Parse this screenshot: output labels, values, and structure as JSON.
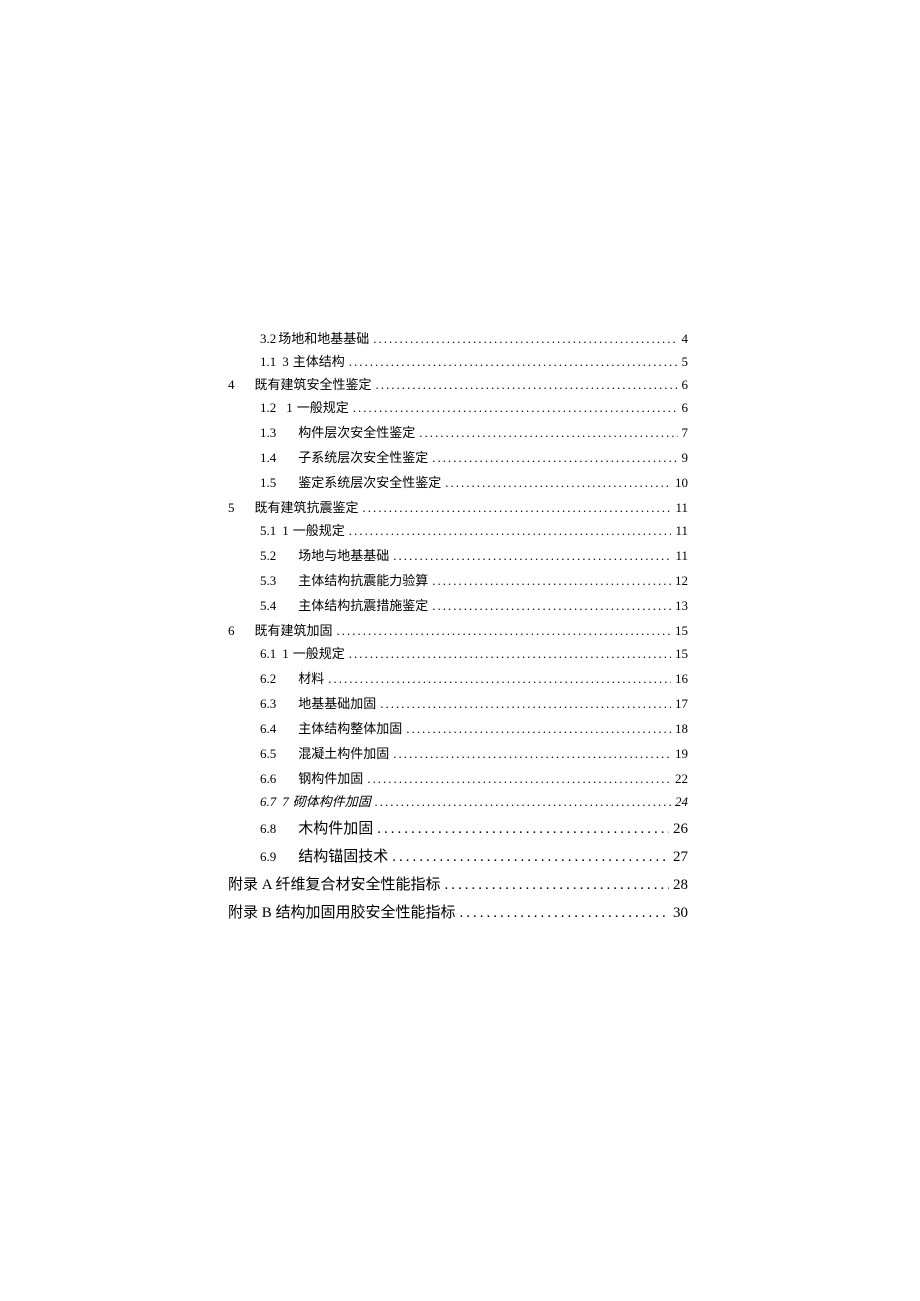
{
  "toc": {
    "r0": {
      "num": "3.2",
      "sub": "",
      "title": "场地和地基基础",
      "page": "4"
    },
    "r1": {
      "num": "1.1",
      "sub": "3",
      "title": "主体结构",
      "page": "5"
    },
    "r2": {
      "num": "4",
      "sub": "",
      "title": "既有建筑安全性鉴定",
      "page": "6"
    },
    "r3": {
      "num": "1.2",
      "sub": "1",
      "title": "一般规定",
      "page": "6"
    },
    "r4": {
      "num": "1.3",
      "sub": "",
      "title": "构件层次安全性鉴定",
      "page": "7"
    },
    "r5": {
      "num": "1.4",
      "sub": "",
      "title": "子系统层次安全性鉴定",
      "page": "9"
    },
    "r6": {
      "num": "1.5",
      "sub": "",
      "title": "鉴定系统层次安全性鉴定",
      "page": "10"
    },
    "r7": {
      "num": "5",
      "sub": "",
      "title": "既有建筑抗震鉴定",
      "page": "11"
    },
    "r8": {
      "num": "5.1",
      "sub": "1",
      "title": "一般规定",
      "page": "11"
    },
    "r9": {
      "num": "5.2",
      "sub": "",
      "title": "场地与地基基础",
      "page": "11"
    },
    "r10": {
      "num": "5.3",
      "sub": "",
      "title": "主体结构抗震能力验算",
      "page": "12"
    },
    "r11": {
      "num": "5.4",
      "sub": "",
      "title": "主体结构抗震措施鉴定",
      "page": "13"
    },
    "r12": {
      "num": "6",
      "sub": "",
      "title": "既有建筑加固",
      "page": "15"
    },
    "r13": {
      "num": "6.1",
      "sub": "1",
      "title": "一般规定",
      "page": "15"
    },
    "r14": {
      "num": "6.2",
      "sub": "",
      "title": "材料",
      "page": "16"
    },
    "r15": {
      "num": "6.3",
      "sub": "",
      "title": "地基基础加固",
      "page": "17"
    },
    "r16": {
      "num": "6.4",
      "sub": "",
      "title": "主体结构整体加固",
      "page": "18"
    },
    "r17": {
      "num": "6.5",
      "sub": "",
      "title": "混凝土构件加固",
      "page": "19"
    },
    "r18": {
      "num": "6.6",
      "sub": "",
      "title": "钢构件加固",
      "page": "22"
    },
    "r19": {
      "num": "6.7",
      "sub": "7",
      "title": "砌体构件加固",
      "page": "24"
    },
    "r20": {
      "num": "6.8",
      "sub": "",
      "title": "木构件加固",
      "page": "26"
    },
    "r21": {
      "num": "6.9",
      "sub": "",
      "title": "结构锚固技术",
      "page": "27"
    },
    "r22": {
      "num": "",
      "sub": "",
      "title": "附录 A 纤维复合材安全性能指标",
      "page": "28"
    },
    "r23": {
      "num": "",
      "sub": "",
      "title": "附录 B 结构加固用胶安全性能指标",
      "page": "30"
    }
  }
}
